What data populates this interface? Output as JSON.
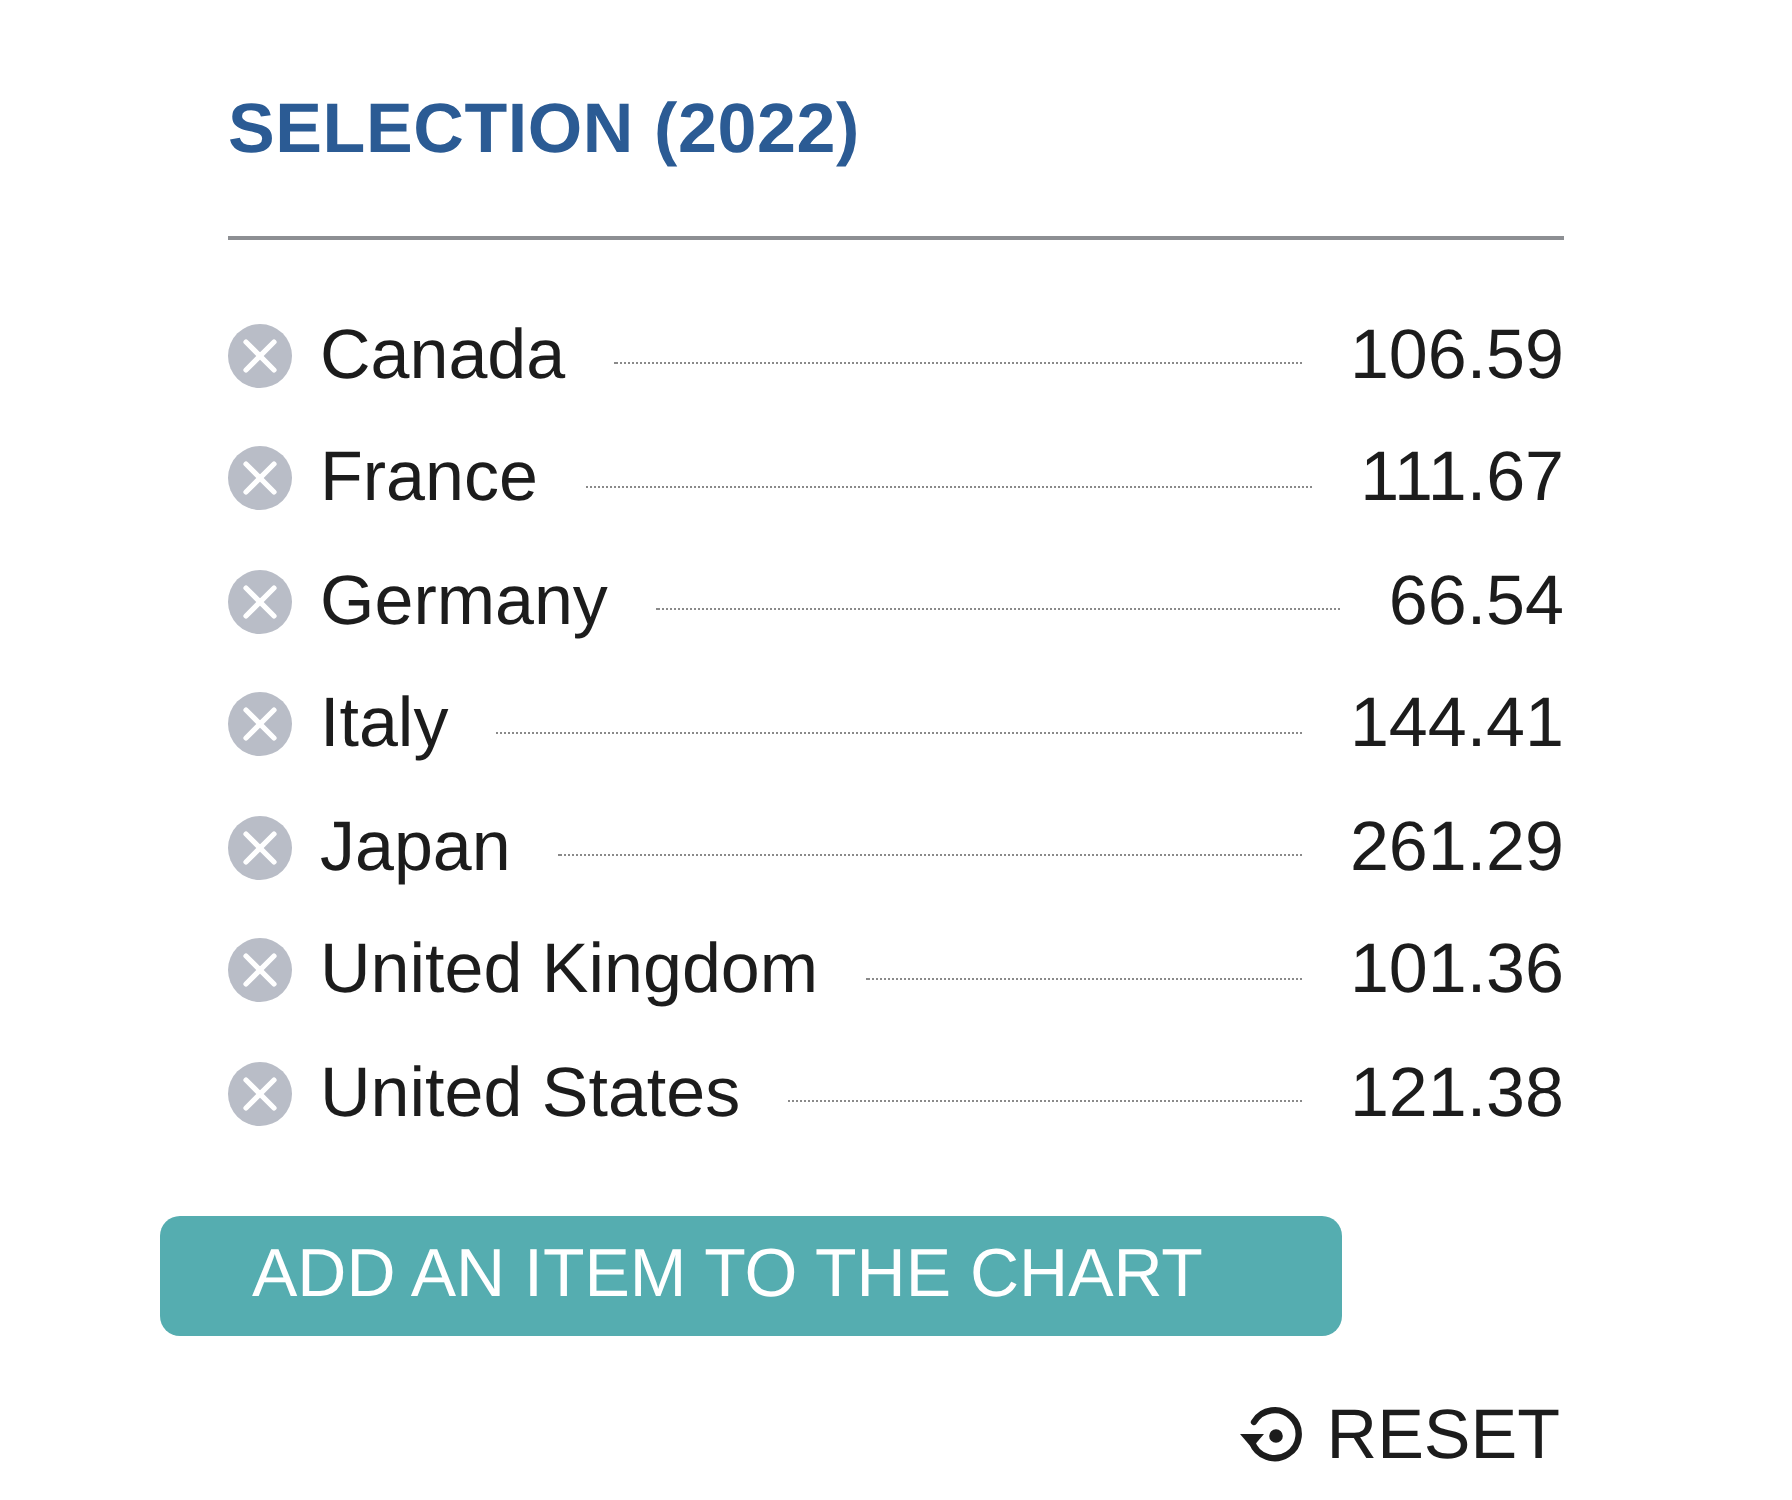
{
  "selection": {
    "title": "SELECTION (2022)"
  },
  "items": [
    {
      "name": "Canada",
      "value": "106.59"
    },
    {
      "name": "France",
      "value": "111.67"
    },
    {
      "name": "Germany",
      "value": "66.54"
    },
    {
      "name": "Italy",
      "value": "144.41"
    },
    {
      "name": "Japan",
      "value": "261.29"
    },
    {
      "name": "United Kingdom",
      "value": "101.36"
    },
    {
      "name": "United States",
      "value": "121.38"
    }
  ],
  "add_button": {
    "label": "ADD AN ITEM TO THE CHART"
  },
  "reset_button": {
    "label": "RESET"
  }
}
